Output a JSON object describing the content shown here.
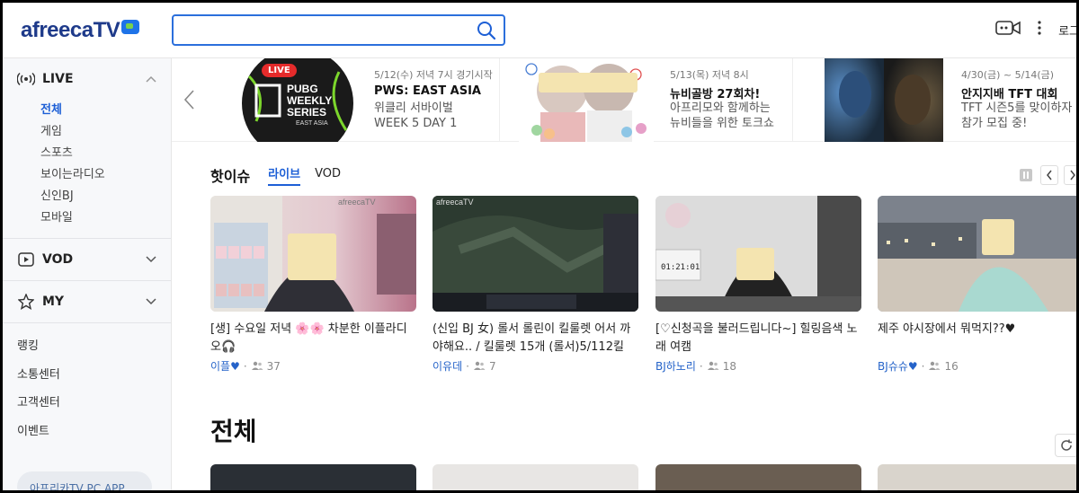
{
  "header": {
    "logo": "afreecaTV",
    "search_placeholder": "",
    "login_label": "로그"
  },
  "sidebar": {
    "live": {
      "label": "LIVE",
      "items": [
        {
          "label": "전체",
          "active": true
        },
        {
          "label": "게임"
        },
        {
          "label": "스포츠"
        },
        {
          "label": "보이는라디오"
        },
        {
          "label": "신인BJ"
        },
        {
          "label": "모바일"
        }
      ]
    },
    "vod_label": "VOD",
    "my_label": "MY",
    "menu": [
      "랭킹",
      "소통센터",
      "고객센터",
      "이벤트"
    ],
    "app_pill": "아프리카TV PC APP"
  },
  "banners": [
    {
      "badge": "LIVE",
      "image_text": [
        "PUBG",
        "WEEKLY",
        "SERIES",
        "EAST ASIA"
      ],
      "date": "5/12(수) 저녁 7시 경기시작",
      "title": "PWS: EAST ASIA",
      "desc_lines": [
        "위클리 서바이벌",
        "WEEK 5 DAY 1"
      ]
    },
    {
      "date": "5/13(목) 저녁 8시",
      "title": "뉴비골방 27회차!",
      "desc_lines": [
        "아프리모와 함께하는",
        "뉴비들을 위한 토크쇼"
      ]
    },
    {
      "date": "4/30(금) ~ 5/14(금)",
      "title": "안지지배 TFT 대회",
      "desc_lines": [
        "TFT 시즌5를 맞이하자",
        "참가 모집 중!"
      ]
    }
  ],
  "hot_issue": {
    "title": "핫이슈",
    "tabs": [
      "라이브",
      "VOD"
    ],
    "cards": [
      {
        "title": "[생] 수요일 저녁 🌸🌸 차분한 이플라디오🎧",
        "bj": "이플♥",
        "viewers": "37",
        "colors": [
          "#d9c7c2",
          "#7d6a6a"
        ],
        "watermark": "afreecaTV"
      },
      {
        "title": "(신입 BJ 女) 롤서 롤린이 킬룰렛 어서 까야해요.. / 킬룰렛 15개 (롤서)5/112킬",
        "bj": "이유데",
        "viewers": "7",
        "colors": [
          "#3a4a3a",
          "#1f2a24"
        ],
        "watermark": "afreecaTV"
      },
      {
        "title": "[♡신청곡을 불러드립니다~] 힐링음색 노래 여캠",
        "bj": "BJ하노리",
        "viewers": "18",
        "colors": [
          "#cfcfcf",
          "#3a3a3a"
        ],
        "timer": "01:21:01"
      },
      {
        "title": "제주 야시장에서 뭐먹지??♥",
        "bj": "BJ슈슈♥",
        "viewers": "16",
        "colors": [
          "#8c8f98",
          "#d9cfc4"
        ]
      }
    ]
  },
  "all_section": {
    "title": "전체"
  },
  "colors": {
    "accent": "#1d5fd6",
    "live_red": "#e52b2b",
    "logo_navy": "#1e3a8a"
  }
}
